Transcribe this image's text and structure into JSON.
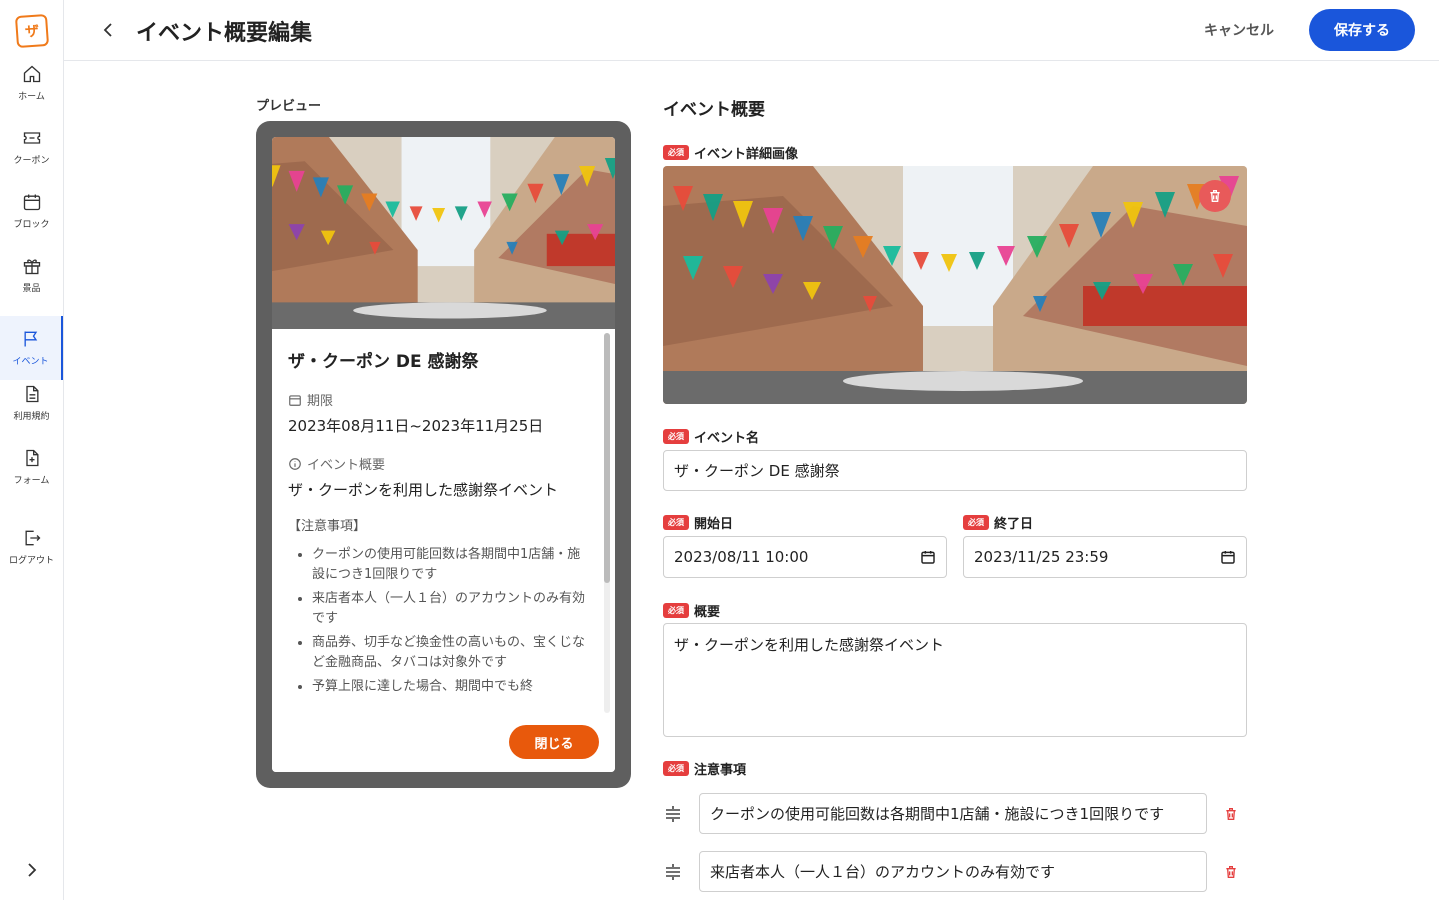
{
  "header": {
    "title": "イベント概要編集",
    "cancel_label": "キャンセル",
    "save_label": "保存する"
  },
  "logo": {
    "text": "ザ"
  },
  "sidebar": {
    "items": [
      {
        "label": "ホーム",
        "icon": "home-icon"
      },
      {
        "label": "クーポン",
        "icon": "ticket-icon"
      },
      {
        "label": "ブロック",
        "icon": "calendar-icon"
      },
      {
        "label": "景品",
        "icon": "gift-icon"
      },
      {
        "label": "イベント",
        "icon": "flag-icon"
      },
      {
        "label": "利用規約",
        "icon": "document-icon"
      },
      {
        "label": "フォーム",
        "icon": "form-add-icon"
      },
      {
        "label": "ログアウト",
        "icon": "logout-icon"
      }
    ],
    "active_index": 4
  },
  "preview": {
    "label": "プレビュー",
    "title": "ザ・クーポン DE 感謝祭",
    "period_label": "期限",
    "period_value": "2023年08月11日~2023年11月25日",
    "summary_label": "イベント概要",
    "summary_value": "ザ・クーポンを利用した感謝祭イベント",
    "notes_heading": "【注意事項】",
    "notes": [
      "クーポンの使用可能回数は各期間中1店舗・施設につき1回限りです",
      "来店者本人（一人１台）のアカウントのみ有効です",
      "商品券、切手など換金性の高いもの、宝くじなど金融商品、タバコは対象外です",
      "予算上限に達した場合、期間中でも終"
    ],
    "close_label": "閉じる"
  },
  "form": {
    "section_title": "イベント概要",
    "required_badge": "必須",
    "image_label": "イベント詳細画像",
    "name_label": "イベント名",
    "name_value": "ザ・クーポン DE 感謝祭",
    "start_label": "開始日",
    "start_value": "2023/08/11 10:00",
    "end_label": "終了日",
    "end_value": "2023/11/25 23:59",
    "summary_label": "概要",
    "summary_value": "ザ・クーポンを利用した感謝祭イベント",
    "notes_label": "注意事項",
    "notes": [
      "クーポンの使用可能回数は各期間中1店舗・施設につき1回限りです",
      "来店者本人（一人１台）のアカウントのみ有効です"
    ]
  },
  "colors": {
    "accent": "#1a56db",
    "brand": "#f07a1a",
    "danger": "#e53e3e",
    "close": "#e8590c"
  }
}
